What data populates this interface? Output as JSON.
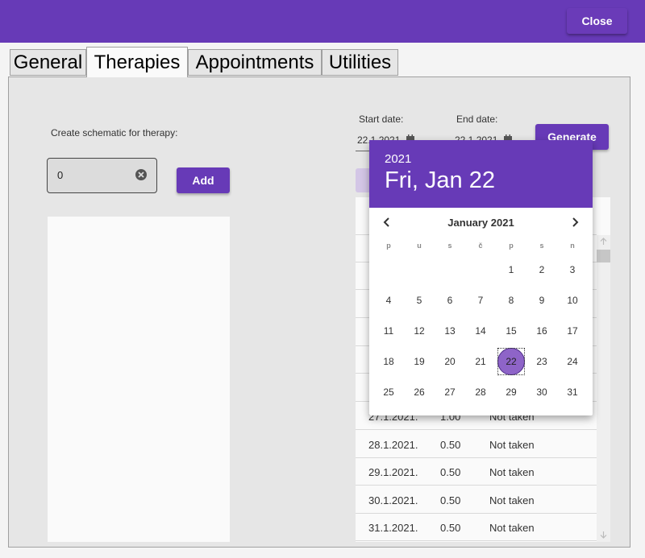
{
  "header": {
    "close_label": "Close"
  },
  "tabs": [
    {
      "label": "General"
    },
    {
      "label": "Therapies"
    },
    {
      "label": "Appointments"
    },
    {
      "label": "Utilities"
    }
  ],
  "therapy": {
    "create_label": "Create schematic for therapy:",
    "number_value": "0",
    "add_label": "Add"
  },
  "dates": {
    "start_label": "Start date:",
    "start_value": "22.1.2021.",
    "end_label": "End date:",
    "end_value": "22.1.2021.",
    "generate_label": "Generate"
  },
  "schedule_rows": [
    {
      "date": "27.1.2021.",
      "dose": "1.00",
      "status": "Not taken"
    },
    {
      "date": "28.1.2021.",
      "dose": "0.50",
      "status": "Not taken"
    },
    {
      "date": "29.1.2021.",
      "dose": "0.50",
      "status": "Not taken"
    },
    {
      "date": "30.1.2021.",
      "dose": "0.50",
      "status": "Not taken"
    },
    {
      "date": "31.1.2021.",
      "dose": "0.50",
      "status": "Not taken"
    }
  ],
  "datepicker": {
    "year": "2021",
    "selected_display": "Fri, Jan 22",
    "month_label": "January 2021",
    "weekdays": [
      "p",
      "u",
      "s",
      "č",
      "p",
      "s",
      "n"
    ],
    "weeks": [
      [
        "",
        "",
        "",
        "",
        "1",
        "2",
        "3"
      ],
      [
        "4",
        "5",
        "6",
        "7",
        "8",
        "9",
        "10"
      ],
      [
        "11",
        "12",
        "13",
        "14",
        "15",
        "16",
        "17"
      ],
      [
        "18",
        "19",
        "20",
        "21",
        "22",
        "23",
        "24"
      ],
      [
        "25",
        "26",
        "27",
        "28",
        "29",
        "30",
        "31"
      ]
    ],
    "selected_day": "22"
  },
  "colors": {
    "accent": "#673ab7"
  }
}
